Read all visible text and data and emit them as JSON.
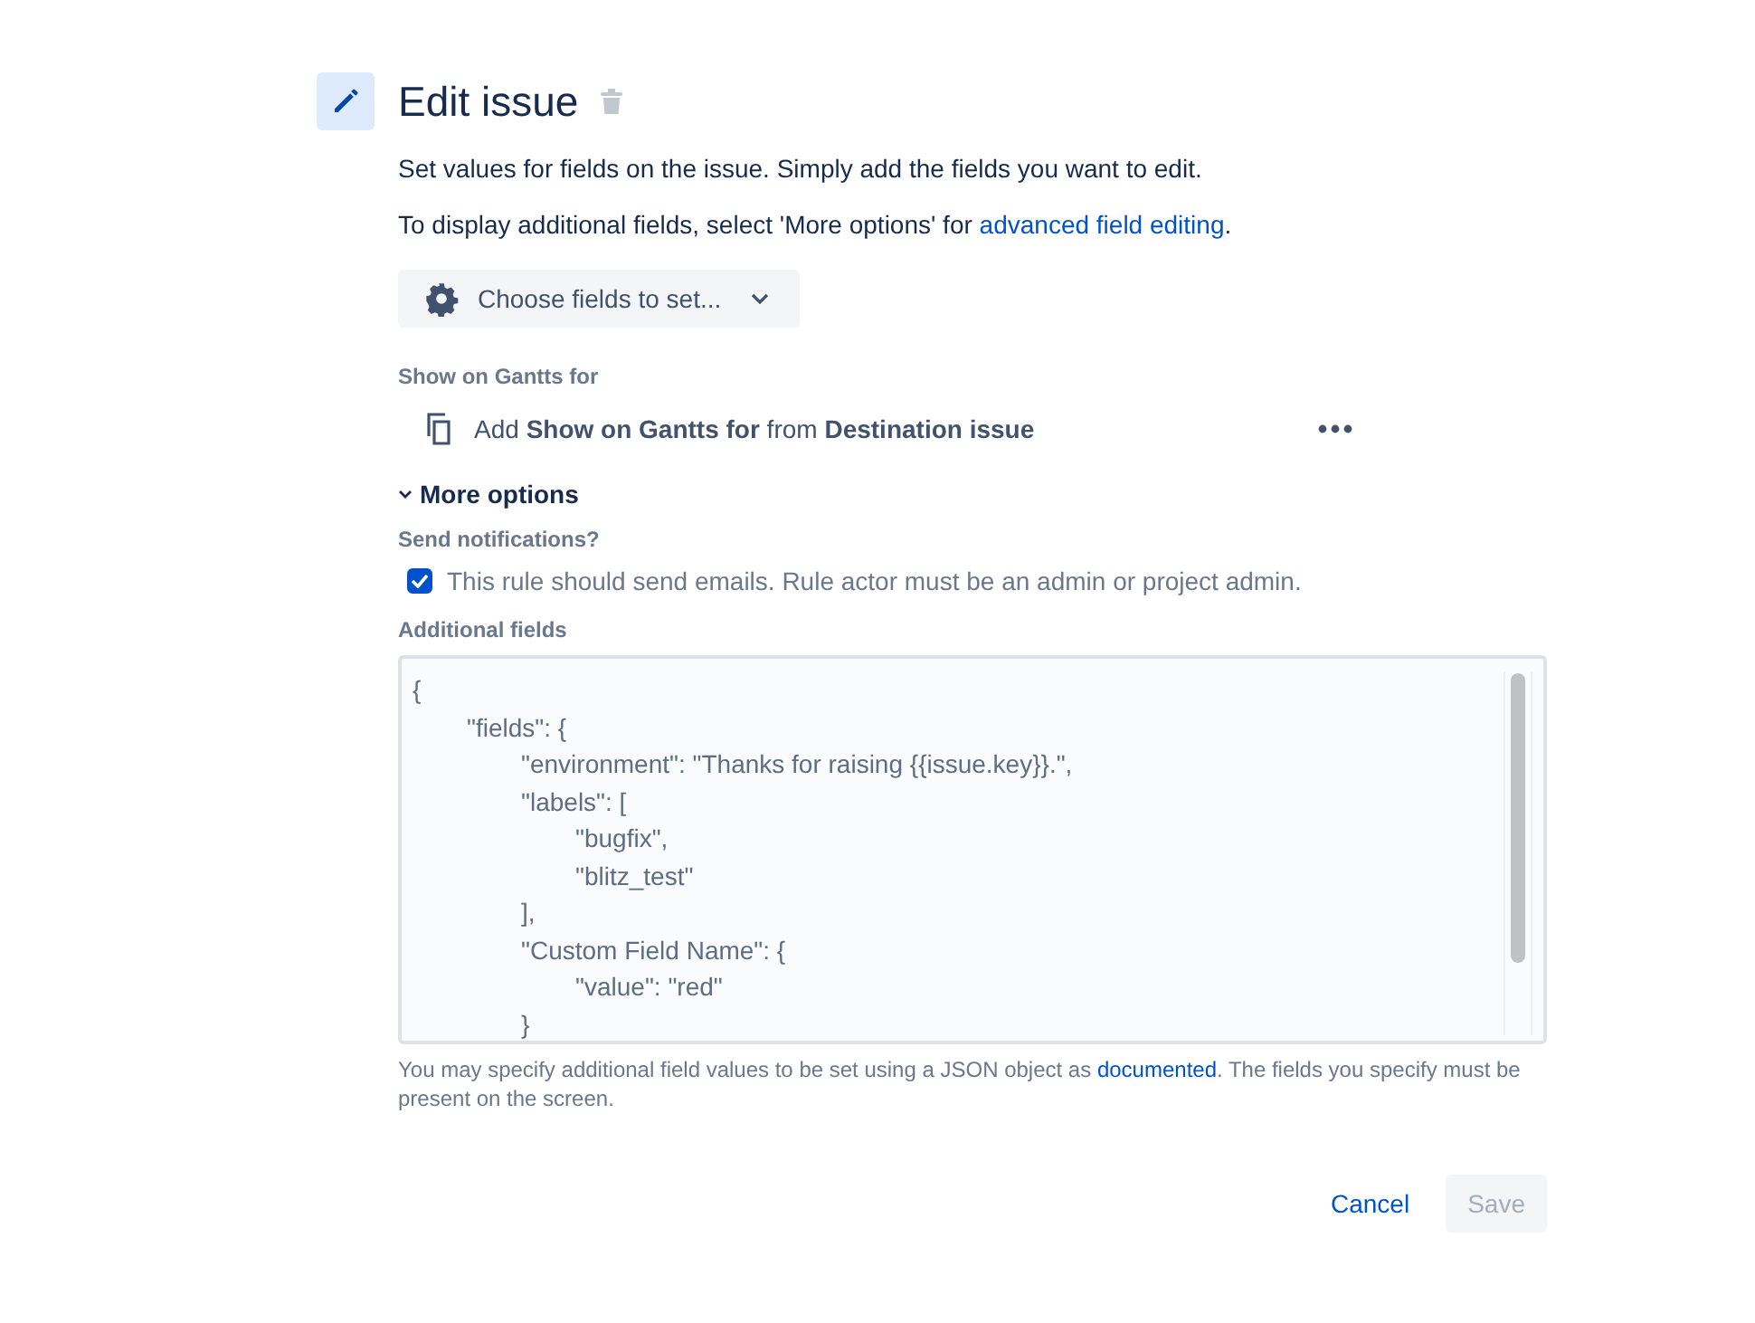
{
  "header": {
    "title": "Edit issue"
  },
  "description": "Set values for fields on the issue. Simply add the fields you want to edit.",
  "hint": {
    "text_before": "To display additional fields, select 'More options' for ",
    "link": "advanced field editing",
    "text_after": "."
  },
  "choose_fields_button": {
    "label": "Choose fields to set..."
  },
  "fields": [
    {
      "label": "Show on Gantts for",
      "value": "Add **Show on Gantts for** from **Destination issue**"
    }
  ],
  "more_options": {
    "label": "More options",
    "expanded": true,
    "send_notifications": {
      "label": "Send notifications?",
      "checkbox_label": "This rule should send emails. Rule actor must be an admin or project admin.",
      "checked": true
    },
    "additional_fields": {
      "label": "Additional fields",
      "value": "{\n\t\"fields\": {\n\t\t\"environment\": \"Thanks for raising {{issue.key}}.\",\n\t\t\"labels\": [\n\t\t\t\"bugfix\",\n\t\t\t\"blitz_test\"\n\t\t],\n\t\t\"Custom Field Name\": {\n\t\t\t\"value\": \"red\"\n\t\t}",
      "help_before": "You may specify additional field values to be set using a JSON object as ",
      "help_link": "documented",
      "help_after": ". The fields you specify must be present on the screen."
    }
  },
  "buttons": [
    {
      "label": "Cancel",
      "kind": "link",
      "disabled": false
    },
    {
      "label": "Save",
      "kind": "primary",
      "disabled": true
    }
  ]
}
